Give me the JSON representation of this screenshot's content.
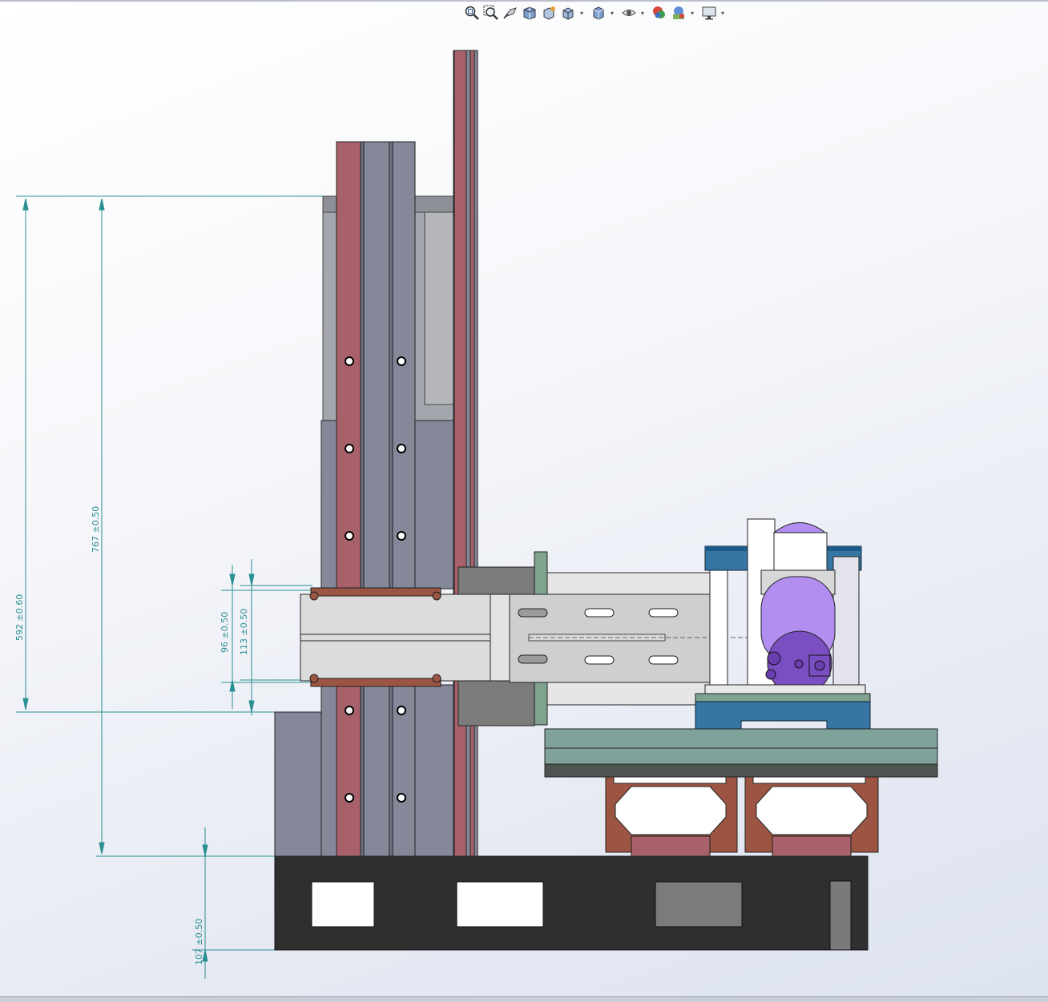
{
  "window": {
    "type": "cad-drawing-view"
  },
  "heads_up_toolbar": {
    "tools": [
      {
        "name": "zoom-to-fit",
        "icon": "zoom-fit-icon",
        "has_menu": false
      },
      {
        "name": "zoom-to-area",
        "icon": "zoom-area-icon",
        "has_menu": false
      },
      {
        "name": "previous-view",
        "icon": "previous-view-icon",
        "has_menu": false
      },
      {
        "name": "section-view",
        "icon": "section-view-icon",
        "has_menu": false
      },
      {
        "name": "dynamic-annotation-views",
        "icon": "annotation-views-icon",
        "has_menu": false
      },
      {
        "name": "view-orientation",
        "icon": "view-orientation-icon",
        "has_menu": true
      },
      {
        "name": "display-style",
        "icon": "display-style-icon",
        "has_menu": true
      },
      {
        "name": "hide-show-items",
        "icon": "hide-show-icon",
        "has_menu": true
      },
      {
        "name": "edit-appearance",
        "icon": "edit-appearance-icon",
        "has_menu": false
      },
      {
        "name": "apply-scene",
        "icon": "apply-scene-icon",
        "has_menu": true
      },
      {
        "name": "view-settings",
        "icon": "monitor-icon",
        "has_menu": true
      }
    ]
  },
  "dimensions": {
    "d1": "592 ±0.60",
    "d2": "767 ±0.50",
    "d3": "96 ±0.50",
    "d4": "113 ±0.50",
    "d5": "107 ±0.50"
  },
  "colors": {
    "rail_red": "#a8616b",
    "column_gray": "#848899",
    "base_black": "#2f2f2f",
    "saddle_brown": "#9b5542",
    "table_green": "#7fa39a",
    "fixture_blue": "#3576a5",
    "motor_purple": "#b28ef0",
    "dimension_teal": "#2a8f92"
  }
}
